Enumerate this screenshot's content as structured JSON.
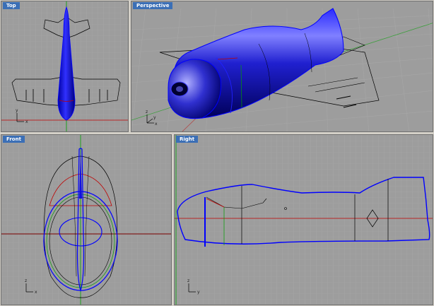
{
  "viewports": {
    "top": {
      "label": "Top"
    },
    "perspective": {
      "label": "Perspective"
    },
    "front": {
      "label": "Front"
    },
    "right": {
      "label": "Right"
    }
  },
  "axis_labels": {
    "x": "x",
    "y": "y",
    "z": "z"
  },
  "colors": {
    "viewport_bg": "#9d9d9d",
    "grid_minor": "#a8a8a8",
    "grid_major": "#8c8c8c",
    "label_bg": "#3b6fb6",
    "highlight_blue": "#1010e0",
    "axis_red": "#c00000",
    "axis_green": "#00a000",
    "app_bg": "#d4d0c8"
  },
  "icons": [
    "axis-triad-icon"
  ]
}
